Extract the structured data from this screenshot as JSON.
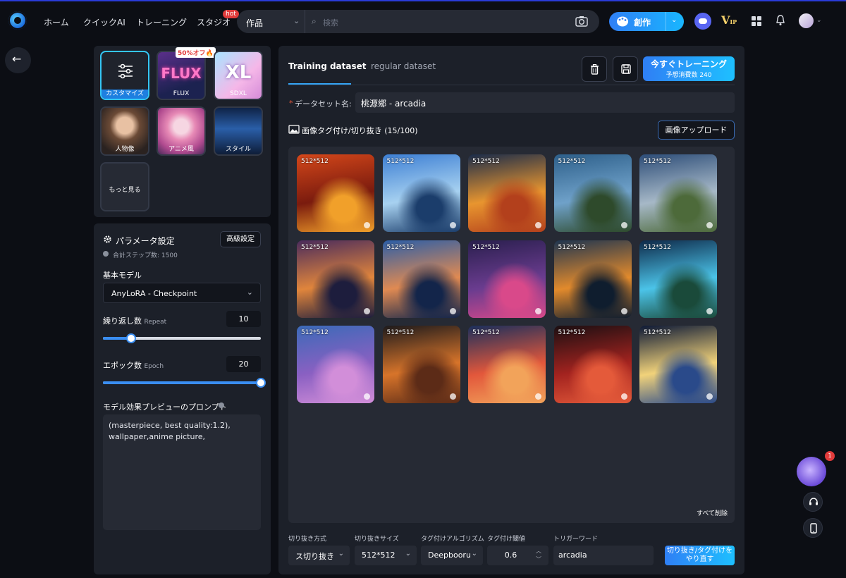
{
  "header": {
    "nav": [
      "ホーム",
      "クイックAI",
      "トレーニング",
      "スタジオ"
    ],
    "hot_badge": "hot",
    "search": {
      "category": "作品",
      "placeholder": "検索"
    },
    "create_label": "創作",
    "vip_label": "V",
    "vip_sub": "IP"
  },
  "model_cards": [
    {
      "label": "カスタマイズ",
      "selected": true
    },
    {
      "label": "FLUX",
      "art": "FLUX",
      "badge": "50%オフ🔥"
    },
    {
      "label": "SDXL",
      "art": "XL"
    },
    {
      "label": "人物像"
    },
    {
      "label": "アニメ風"
    },
    {
      "label": "スタイル"
    },
    {
      "label": "もっと見る"
    }
  ],
  "params": {
    "title": "パラメータ設定",
    "advanced_button": "高級設定",
    "total_steps": "合計ステップ数: 1500",
    "base_model_label": "基本モデル",
    "base_model_value": "AnyLoRA - Checkpoint",
    "repeat_label": "繰り返し数",
    "repeat_sub": "Repeat",
    "repeat_value": "10",
    "repeat_fraction": 0.18,
    "epoch_label": "エポック数",
    "epoch_sub": "Epoch",
    "epoch_value": "20",
    "epoch_fraction": 1.0,
    "prompt_label": "モデル効果プレビューのプロンプト",
    "prompt_text": "(masterpiece, best quality:1.2), wallpaper,anime picture,"
  },
  "dataset": {
    "tabs": [
      "Training dataset",
      "regular dataset"
    ],
    "active_tab": 0,
    "train_button": "今すぐトレーニング",
    "train_cost": "予想消費数 240",
    "name_label": "データセット名:",
    "name_required": "*",
    "name_value": "桃源郷 - arcadia",
    "images_label": "画像タグ付け/切り抜き (15/100)",
    "upload_button": "画像アップロード",
    "delete_all": "すべて削除",
    "image_resolution": "512*512",
    "images": [
      {
        "colors": [
          "#d4471a",
          "#7a1b0e",
          "#f1a02a"
        ]
      },
      {
        "colors": [
          "#3d7fd4",
          "#a7d1f0",
          "#1b3d6b"
        ]
      },
      {
        "colors": [
          "#1b2c4a",
          "#e8952f",
          "#b3401c"
        ]
      },
      {
        "colors": [
          "#2d5f8a",
          "#6fa1c9",
          "#2e4a2b"
        ]
      },
      {
        "colors": [
          "#2d4d78",
          "#a6b8c7",
          "#4d6a3a"
        ]
      },
      {
        "colors": [
          "#4a2b5c",
          "#e0853c",
          "#1d1d3d"
        ]
      },
      {
        "colors": [
          "#2c5ea7",
          "#e08a52",
          "#13254a"
        ]
      },
      {
        "colors": [
          "#2a1f4e",
          "#6a3c8f",
          "#d9498a"
        ]
      },
      {
        "colors": [
          "#1f3550",
          "#e28a2c",
          "#0f1d2e"
        ]
      },
      {
        "colors": [
          "#0e2a4a",
          "#4bc3e8",
          "#1a4a3a"
        ]
      },
      {
        "colors": [
          "#3b6ab8",
          "#8a60c2",
          "#d28ed9"
        ]
      },
      {
        "colors": [
          "#1d1a1c",
          "#d7742a",
          "#5c2b17"
        ]
      },
      {
        "colors": [
          "#1b2f5c",
          "#e2573b",
          "#f2a35a"
        ]
      },
      {
        "colors": [
          "#1b0f12",
          "#a3231f",
          "#e45a3a"
        ]
      },
      {
        "colors": [
          "#0d1936",
          "#f1d27a",
          "#2a4a8a"
        ]
      }
    ]
  },
  "footer_controls": {
    "crop_method_label": "切り抜き方式",
    "crop_method_value": "ス切り抜き",
    "crop_size_label": "切り抜きサイズ",
    "crop_size_value": "512*512",
    "tag_algo_label": "タグ付けアルゴリズム",
    "tag_algo_value": "Deepbooru",
    "tag_threshold_label": "タグ付け閾値",
    "tag_threshold_value": "0.6",
    "trigger_label": "トリガーワード",
    "trigger_value": "arcadia",
    "go_button": "切り抜き/タグ付けを やり直す"
  },
  "floating": {
    "notify_count": "1"
  }
}
